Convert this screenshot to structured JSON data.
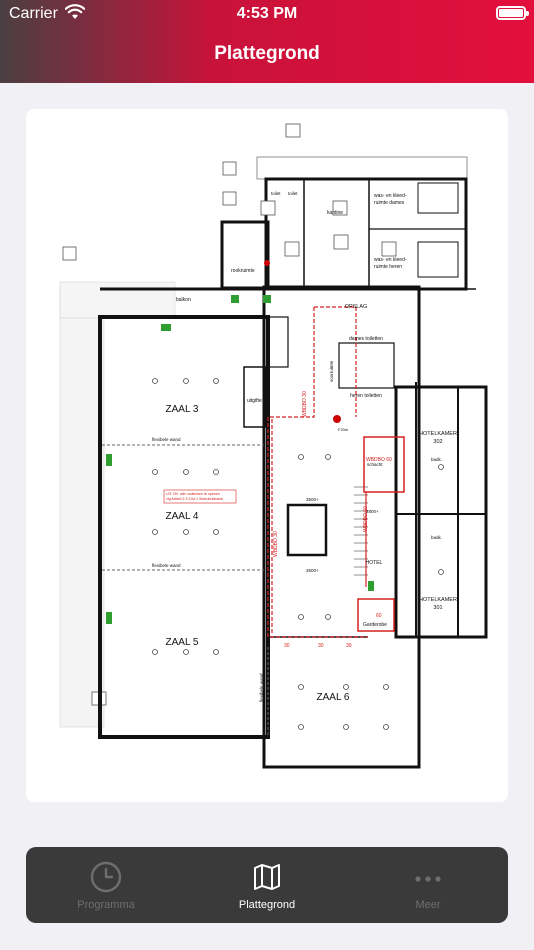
{
  "status_bar": {
    "carrier": "Carrier",
    "time": "4:53 PM"
  },
  "header": {
    "title": "Plattegrond"
  },
  "floorplan": {
    "rooms": {
      "zaal3": "ZAAL 3",
      "zaal4": "ZAAL 4",
      "zaal5": "ZAAL 5",
      "zaal6": "ZAAL 6",
      "hotelkamer302": "HOTELKAMER",
      "hotelkamer302_nr": "302",
      "hotelkamer301": "HOTELKAMER",
      "hotelkamer301_nr": "301",
      "hotel": "HOTEL",
      "garderobe": "Garderobe",
      "kantine": "kantine",
      "opslag": "OPSLAG",
      "dames_toiletten": "dames toiletten",
      "heren_toiletten": "heren toiletten",
      "was_dames_1": "was- en kleed-",
      "was_dames_2": "ruimte dames",
      "was_heren_1": "was- en kleed-",
      "was_heren_2": "ruimte heren",
      "toilet_a": "toilet",
      "toilet_b": "toilet",
      "rookruimte": "rookruimte",
      "balkon": "balkon",
      "uitgifte": "uitgifte",
      "voorruimte": "voorruimte",
      "schacht": "schacht",
      "badk_a": "badk.",
      "badk_b": "badk."
    },
    "labels": {
      "flex_wand_1": "flexibele wand",
      "flex_wand_2": "flexibele wand",
      "flex_wand_3": "flexibele wand",
      "wbdbo_1": "WBDBO 30",
      "wbdbo_2": "WBDBO 30",
      "wbdbo_3": "WBDBO 60",
      "wbdbo_4": "WBDBO 60",
      "level_1": "3500+",
      "level_2": "3500+",
      "level_3": "2800+",
      "note_1": "UIT OK: alle rookluiken te openen",
      "note_2": "vlg Artikel 2.3.3 lid 1 Subrubriekstuk",
      "f30_a": "30",
      "f30_b": "30",
      "f30_c": "30",
      "f60": "60",
      "f20m": "F20m"
    }
  },
  "tabs": [
    {
      "label": "Programma",
      "icon": "clock-icon",
      "active": false
    },
    {
      "label": "Plattegrond",
      "icon": "map-icon",
      "active": true
    },
    {
      "label": "Meer",
      "icon": "more-icon",
      "active": false
    }
  ],
  "colors": {
    "accent": "#e30f3c",
    "tab_active": "#ffffff",
    "tab_inactive": "#6e6e6e",
    "fire_line": "#d62020",
    "exit_sign": "#2e9e2e"
  }
}
